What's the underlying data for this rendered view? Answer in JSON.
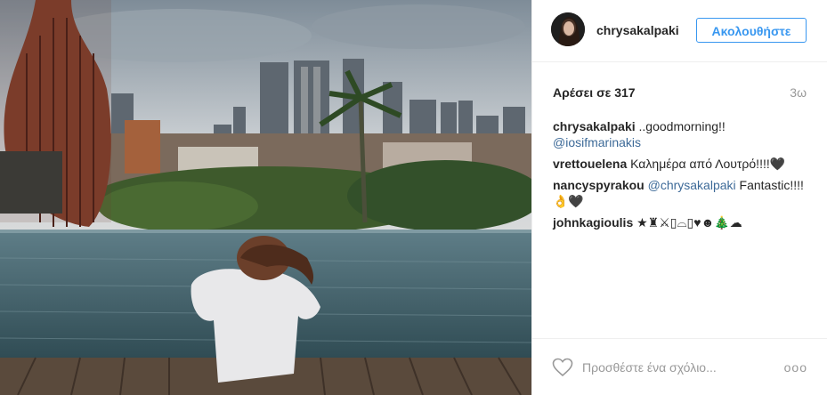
{
  "post": {
    "username": "chrysakalpaki",
    "follow_label": "Ακολουθήστε",
    "likes_text": "Αρέσει σε 317",
    "timestamp": "3ω"
  },
  "comments": [
    {
      "user": "chrysakalpaki",
      "text": "..goodmorning!!",
      "mention": "@iosifmarinakis"
    },
    {
      "user": "vrettouelena",
      "text": "Καλημέρα από Λουτρό!!!!🖤"
    },
    {
      "user": "nancyspyrakou",
      "mention": "@chrysakalpaki",
      "text": "Fantastic!!!!",
      "emoji": "👌🖤"
    },
    {
      "user": "johnkagioulis",
      "emoji": "★♜⚔▯⌓▯♥☻🎄☁"
    }
  ],
  "footer": {
    "add_comment_placeholder": "Προσθέστε ένα σχόλιο...",
    "more_label": "ooo"
  },
  "icons": {
    "like": "heart-icon",
    "more": "more-options-icon"
  },
  "colors": {
    "accent": "#3897f0",
    "mention": "#3d6a98",
    "muted": "#999999"
  }
}
